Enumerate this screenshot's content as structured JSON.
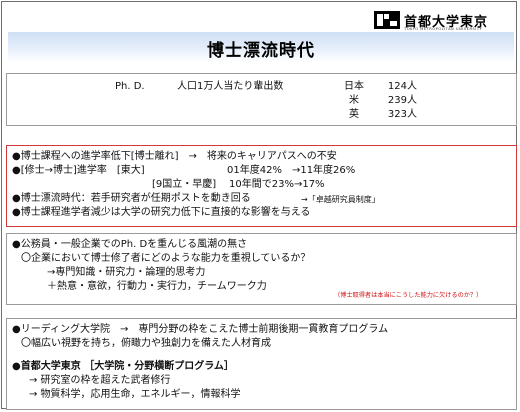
{
  "header": {
    "logo_text": "首都大学東京",
    "logo_sub": "TOKYO METROPOLITAN UNIVERSITY",
    "title": "博士漂流時代"
  },
  "phd_box": {
    "label": "Ph. D.",
    "metric": "人口1万人当たり輩出数",
    "rows": [
      {
        "country": "日本",
        "value": "124人"
      },
      {
        "country": "米",
        "value": "239人"
      },
      {
        "country": "英",
        "value": "323人"
      }
    ]
  },
  "issues": {
    "line1": "●博士課程への進学率低下[博士離れ]　→　将来のキャリアパスへの不安",
    "line2a": "●[修士→博士]進学率　[東大]",
    "line2b": "01年度42%　→11年度26%",
    "line3a": "[9国立・早慶]",
    "line3b": "10年間で23%→17%",
    "line4a": "●博士漂流時代：若手研究者が任期ポストを動き回る",
    "line4b": "→「卓越研究員制度」",
    "line5": "●博士課程進学者減少は大学の研究力低下に直接的な影響を与える"
  },
  "society": {
    "line1": "●公務員・一般企業でのPh. Dを重んじる風潮の無さ",
    "line2": "〇企業において博士修了者にどのような能力を重視しているか？",
    "line3": "→専門知識・研究力・論理的思考力",
    "line4": "＋熱意・意欲，行動力・実行力，チームワーク力",
    "note": "（博士取得者は本当にこうした能力に欠けるのか？）"
  },
  "programs": {
    "line1": "●リーディング大学院　→　専門分野の枠をこえた博士前期後期一貫教育プログラム",
    "line2": "〇幅広い視野を持ち，俯瞰力や独創力を備えた人材育成",
    "line3": "●首都大学東京 ［大学院・分野横断プログラム］",
    "line4": "→ 研究室の枠を超えた武者修行",
    "line5": "→ 物質科学，応用生命，エネルギー，情報科学"
  }
}
